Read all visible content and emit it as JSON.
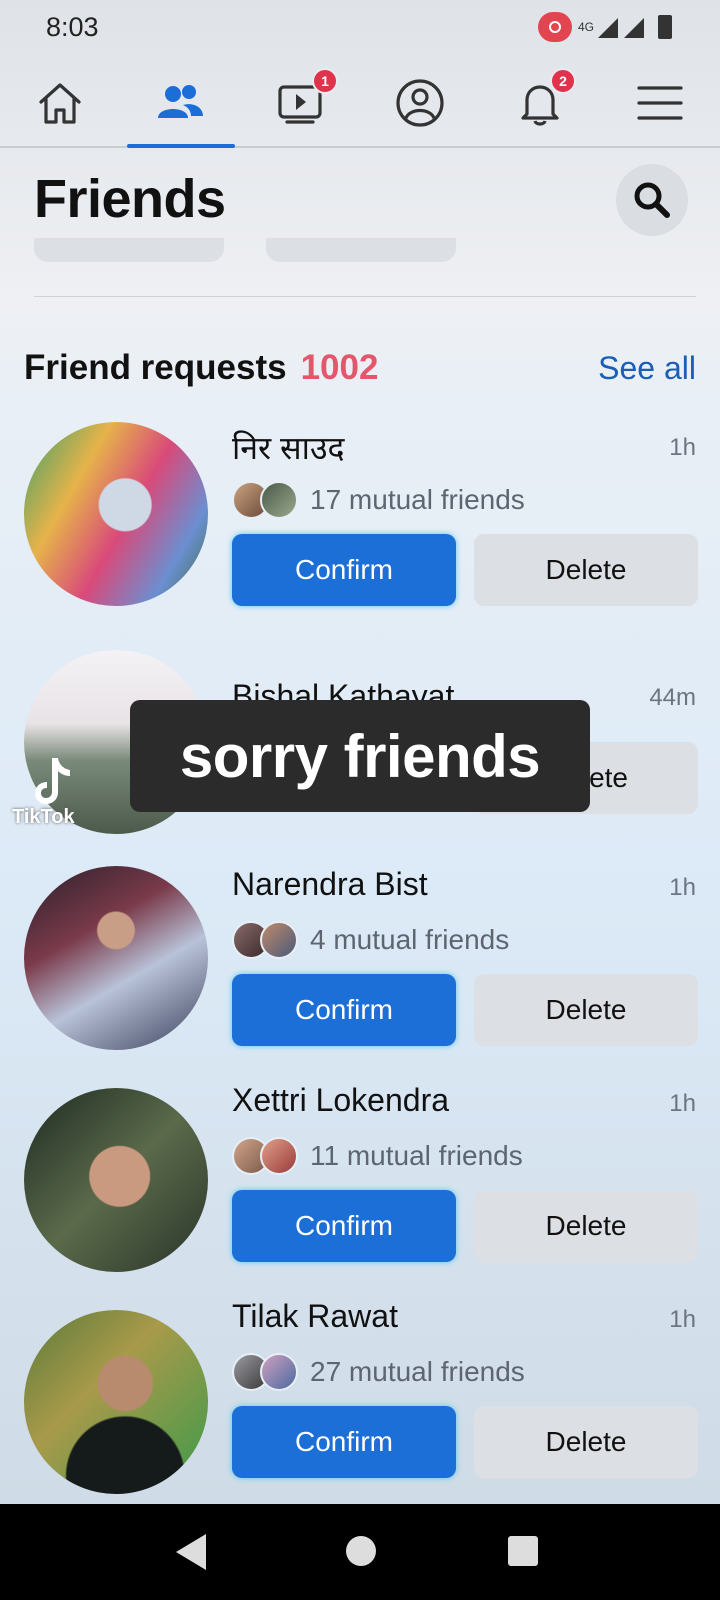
{
  "status": {
    "time": "8:03",
    "network": "4G"
  },
  "nav": {
    "tabs": [
      {
        "icon": "home-icon"
      },
      {
        "icon": "friends-icon",
        "active": true
      },
      {
        "icon": "video-icon",
        "badge": "1"
      },
      {
        "icon": "profile-icon"
      },
      {
        "icon": "bell-icon",
        "badge": "2"
      },
      {
        "icon": "menu-icon"
      }
    ]
  },
  "page": {
    "title": "Friends"
  },
  "requests": {
    "heading": "Friend requests",
    "count": "1002",
    "see_all": "See all",
    "items": [
      {
        "name": "निर साउद",
        "time": "1h",
        "mutual": "17 mutual friends",
        "confirm": "Confirm",
        "delete": "Delete"
      },
      {
        "name": "Bishal Kathayat",
        "time": "44m",
        "delete_partial": "ete"
      },
      {
        "name": "Narendra Bist",
        "time": "1h",
        "mutual": "4 mutual friends",
        "confirm": "Confirm",
        "delete": "Delete"
      },
      {
        "name": "Xettri Lokendra",
        "time": "1h",
        "mutual": "11 mutual friends",
        "confirm": "Confirm",
        "delete": "Delete"
      },
      {
        "name": "Tilak Rawat",
        "time": "1h",
        "mutual": "27 mutual friends",
        "confirm": "Confirm",
        "delete": "Delete"
      }
    ]
  },
  "overlay": {
    "caption": "sorry friends",
    "watermark": "TikTok"
  },
  "colors": {
    "accent": "#1c6fd6",
    "count": "#e4566b",
    "badge": "#e0334b"
  }
}
